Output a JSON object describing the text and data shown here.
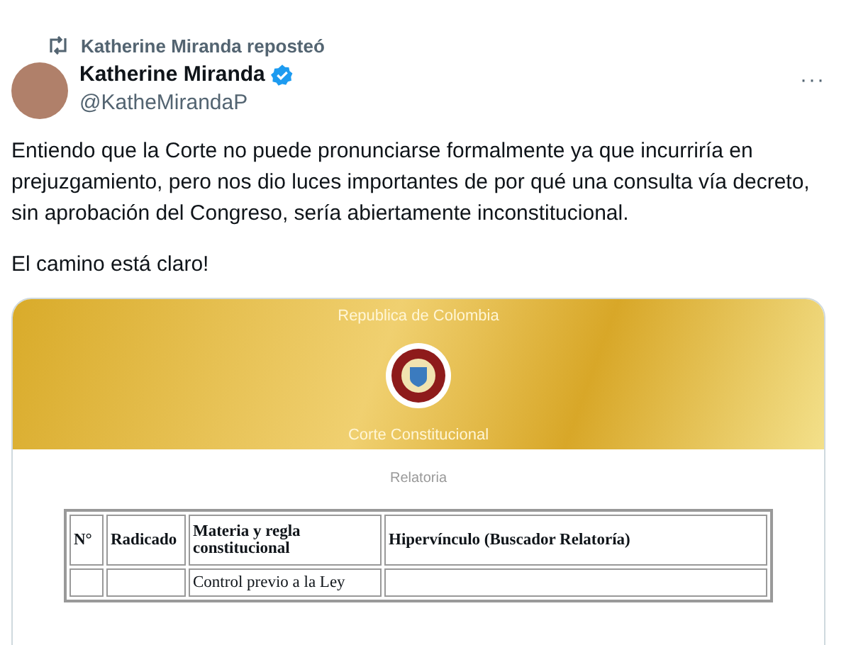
{
  "repost": {
    "text": "Katherine Miranda reposteó"
  },
  "author": {
    "name": "Katherine Miranda",
    "handle": "@KatheMirandaP",
    "verified": true
  },
  "more": "···",
  "body": [
    "Entiendo que la Corte no puede pronunciarse formalmente ya que incurriría en prejuzgamiento, pero nos dio luces importantes de por qué una consulta vía decreto, sin aprobación del Congreso, sería abiertamente inconstitucional.",
    "El camino está claro!"
  ],
  "document": {
    "banner_top": "Republica de Colombia",
    "banner_bottom": "Corte Constitucional",
    "subtitle": "Relatoria",
    "table": {
      "columns": [
        "N°",
        "Radicado",
        "Materia y regla constitucional",
        "Hipervínculo (Buscador Relatoría)"
      ],
      "rows": [
        [
          "",
          "",
          "Control previo a la Ley",
          ""
        ]
      ]
    }
  }
}
